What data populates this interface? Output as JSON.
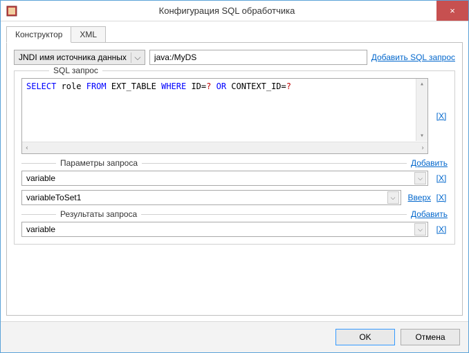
{
  "window": {
    "title": "Конфигурация SQL обработчика",
    "close_icon": "×"
  },
  "tabs": {
    "constructor": "Конструктор",
    "xml": "XML"
  },
  "top": {
    "datasource_label": "JNDI имя источника данных",
    "datasource_value": "java:/MyDS",
    "add_query_link": "Добавить SQL запрос"
  },
  "sql": {
    "group_label": "SQL запрос",
    "delete_x": "[X]",
    "tokens": {
      "select": "SELECT",
      "role": " role ",
      "from": "FROM",
      "ext_table": " EXT_TABLE ",
      "where": "WHERE",
      "id_eq": " ID=",
      "q1": "?",
      "or": " OR",
      "context_eq": " CONTEXT_ID=",
      "q2": "?"
    },
    "scroll_left": "‹",
    "scroll_right": "›",
    "scroll_up": "▴",
    "scroll_down": "▾"
  },
  "params": {
    "group_label": "Параметры запроса",
    "add_link": "Добавить",
    "delete_x": "[X]",
    "up_link": "Вверх",
    "rows": [
      {
        "value": "variable"
      },
      {
        "value": "variableToSet1"
      }
    ]
  },
  "results": {
    "group_label": "Результаты запроса",
    "add_link": "Добавить",
    "delete_x": "[X]",
    "rows": [
      {
        "value": "variable"
      }
    ]
  },
  "buttons": {
    "ok": "OK",
    "cancel": "Отмена"
  },
  "caret": "⌵"
}
